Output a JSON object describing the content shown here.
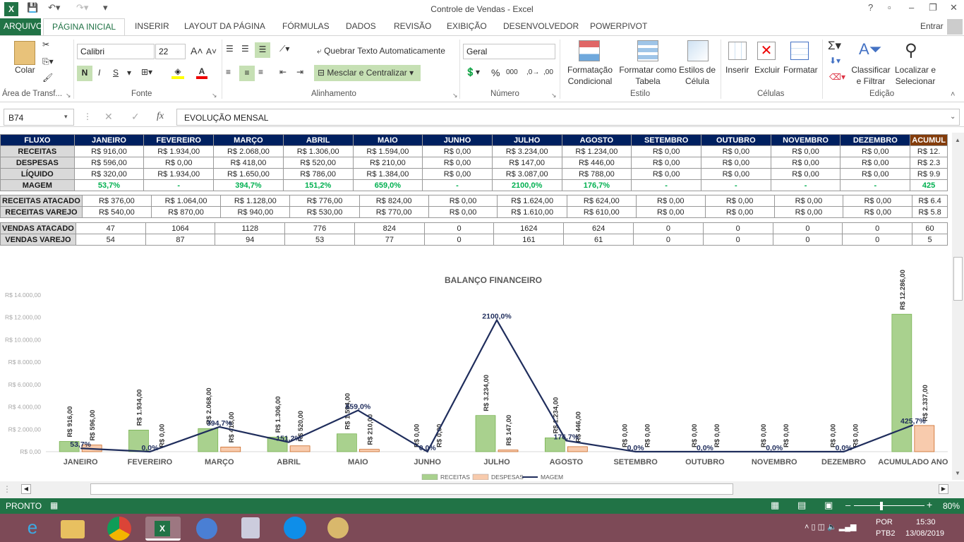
{
  "window": {
    "title": "Controle de Vendas - Excel"
  },
  "titlebar_buttons": [
    "?",
    "▫",
    "–",
    "❐",
    "✕"
  ],
  "tabs": [
    "ARQUIVO",
    "PÁGINA INICIAL",
    "INSERIR",
    "LAYOUT DA PÁGINA",
    "FÓRMULAS",
    "DADOS",
    "REVISÃO",
    "EXIBIÇÃO",
    "DESENVOLVEDOR",
    "POWERPIVOT"
  ],
  "signin": "Entrar",
  "ribbon": {
    "paste": "Colar",
    "clipboard_group": "Área de Transf...",
    "font_name": "Calibri",
    "font_size": "22",
    "bold": "N",
    "italic": "I",
    "underline": "S",
    "font_group": "Fonte",
    "wrap_text": "Quebrar Texto Automaticamente",
    "merge_center": "Mesclar e Centralizar",
    "align_group": "Alinhamento",
    "number_format": "Geral",
    "number_group": "Número",
    "cond_format": [
      "Formatação",
      "Condicional"
    ],
    "format_table": [
      "Formatar como",
      "Tabela"
    ],
    "cell_styles": [
      "Estilos de",
      "Célula"
    ],
    "styles_group": "Estilo",
    "insert": "Inserir",
    "delete": "Excluir",
    "format": "Formatar",
    "cells_group": "Células",
    "sort_filter": [
      "Classificar",
      "e Filtrar"
    ],
    "find_select": [
      "Localizar e",
      "Selecionar"
    ],
    "edit_group": "Edição"
  },
  "formula_bar": {
    "name_box": "B74",
    "fx": "fx",
    "content": "EVOLUÇÃO MENSAL"
  },
  "table": {
    "header": [
      "FLUXO",
      "JANEIRO",
      "FEVEREIRO",
      "MARÇO",
      "ABRIL",
      "MAIO",
      "JUNHO",
      "JULHO",
      "AGOSTO",
      "SETEMBRO",
      "OUTUBRO",
      "NOVEMBRO",
      "DEZEMBRO",
      "ACUMUL"
    ],
    "rows1": [
      [
        "RECEITAS",
        "R$ 916,00",
        "R$ 1.934,00",
        "R$ 2.068,00",
        "R$ 1.306,00",
        "R$ 1.594,00",
        "R$ 0,00",
        "R$ 3.234,00",
        "R$ 1.234,00",
        "R$ 0,00",
        "R$ 0,00",
        "R$ 0,00",
        "R$ 0,00",
        "R$ 12."
      ],
      [
        "DESPESAS",
        "R$ 596,00",
        "R$ 0,00",
        "R$ 418,00",
        "R$ 520,00",
        "R$ 210,00",
        "R$ 0,00",
        "R$ 147,00",
        "R$ 446,00",
        "R$ 0,00",
        "R$ 0,00",
        "R$ 0,00",
        "R$ 0,00",
        "R$ 2.3"
      ],
      [
        "LÍQUIDO",
        "R$ 320,00",
        "R$ 1.934,00",
        "R$ 1.650,00",
        "R$ 786,00",
        "R$ 1.384,00",
        "R$ 0,00",
        "R$ 3.087,00",
        "R$ 788,00",
        "R$ 0,00",
        "R$ 0,00",
        "R$ 0,00",
        "R$ 0,00",
        "R$ 9.9"
      ],
      [
        "MAGEM",
        "53,7%",
        "-",
        "394,7%",
        "151,2%",
        "659,0%",
        "-",
        "2100,0%",
        "176,7%",
        "-",
        "-",
        "-",
        "-",
        "425"
      ]
    ],
    "rows2": [
      [
        "RECEITAS ATACADO",
        "R$ 376,00",
        "R$ 1.064,00",
        "R$ 1.128,00",
        "R$ 776,00",
        "R$ 824,00",
        "R$ 0,00",
        "R$ 1.624,00",
        "R$ 624,00",
        "R$ 0,00",
        "R$ 0,00",
        "R$ 0,00",
        "R$ 0,00",
        "R$ 6.4"
      ],
      [
        "RECEITAS VAREJO",
        "R$ 540,00",
        "R$ 870,00",
        "R$ 940,00",
        "R$ 530,00",
        "R$ 770,00",
        "R$ 0,00",
        "R$ 1.610,00",
        "R$ 610,00",
        "R$ 0,00",
        "R$ 0,00",
        "R$ 0,00",
        "R$ 0,00",
        "R$ 5.8"
      ]
    ],
    "rows3": [
      [
        "VENDAS ATACADO",
        "47",
        "1064",
        "1128",
        "776",
        "824",
        "0",
        "1624",
        "624",
        "0",
        "0",
        "0",
        "0",
        "60"
      ],
      [
        "VENDAS VAREJO",
        "54",
        "87",
        "94",
        "53",
        "77",
        "0",
        "161",
        "61",
        "0",
        "0",
        "0",
        "0",
        "5"
      ]
    ]
  },
  "chart_data": {
    "type": "bar",
    "title": "BALANÇO FINANCEIRO",
    "categories": [
      "JANEIRO",
      "FEVEREIRO",
      "MARÇO",
      "ABRIL",
      "MAIO",
      "JUNHO",
      "JULHO",
      "AGOSTO",
      "SETEMBRO",
      "OUTUBRO",
      "NOVEMBRO",
      "DEZEMBRO",
      "ACUMULADO ANO"
    ],
    "series": [
      {
        "name": "RECEITAS",
        "type": "bar",
        "color": "#a9d18e",
        "values": [
          916,
          1934,
          2068,
          1306,
          1594,
          0,
          3234,
          1234,
          0,
          0,
          0,
          0,
          12286
        ],
        "labels": [
          "R$ 916,00",
          "R$ 1.934,00",
          "R$ 2.068,00",
          "R$ 1.306,00",
          "R$ 1.594,00",
          "R$ 0,00",
          "R$ 3.234,00",
          "R$ 1.234,00",
          "R$ 0,00",
          "R$ 0,00",
          "R$ 0,00",
          "R$ 0,00",
          "R$ 12.286,00"
        ]
      },
      {
        "name": "DESPESAS",
        "type": "bar",
        "color": "#f8cbad",
        "values": [
          596,
          0,
          418,
          520,
          210,
          0,
          147,
          446,
          0,
          0,
          0,
          0,
          2337
        ],
        "labels": [
          "R$ 596,00",
          "R$ 0,00",
          "R$ 418,00",
          "R$ 520,00",
          "R$ 210,00",
          "R$ 0,00",
          "R$ 147,00",
          "R$ 446,00",
          "R$ 0,00",
          "R$ 0,00",
          "R$ 0,00",
          "R$ 0,00",
          "R$ 2.337,00"
        ]
      },
      {
        "name": "MAGEM",
        "type": "line",
        "color": "#1f2d5c",
        "values": [
          53.7,
          0,
          394.7,
          151.2,
          659,
          0,
          2100,
          176.7,
          0,
          0,
          0,
          0,
          425.7
        ],
        "labels": [
          "53,7%",
          "0,0%",
          "394,7%",
          "151,2%",
          "659,0%",
          "0,0%",
          "2100,0%",
          "176,7%",
          "0,0%",
          "0,0%",
          "0,0%",
          "0,0%",
          "425,7%"
        ]
      }
    ],
    "yticks": [
      "R$ 0,00",
      "R$ 2.000,00",
      "R$ 4.000,00",
      "R$ 6.000,00",
      "R$ 8.000,00",
      "R$ 10.000,00",
      "R$ 12.000,00",
      "R$ 14.000,00"
    ],
    "ylim": [
      0,
      14000
    ],
    "ylim_secondary": [
      0,
      2500
    ],
    "legend": "bottom"
  },
  "status": {
    "mode": "PRONTO",
    "zoom": "80%"
  },
  "taskbar": {
    "lang1": "POR",
    "lang2": "PTB2",
    "time": "15:30",
    "date": "13/08/2019"
  }
}
